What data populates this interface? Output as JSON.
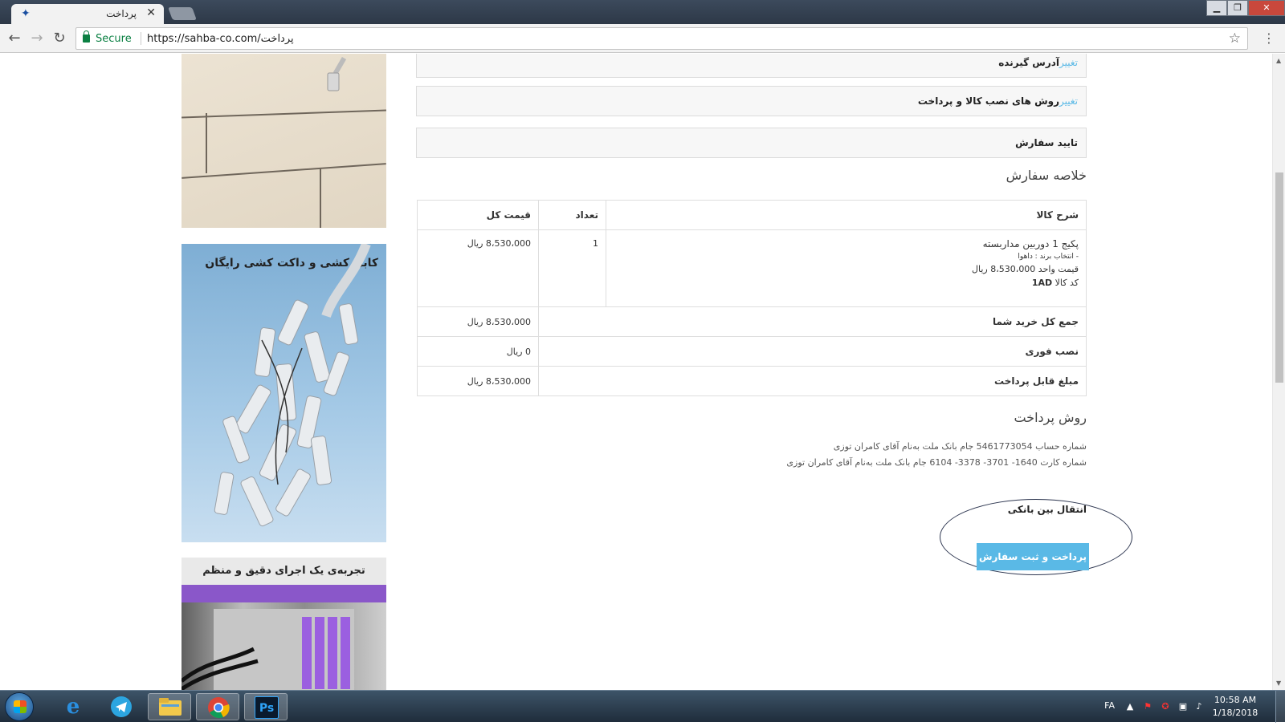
{
  "browser": {
    "tab_title": "پرداخت",
    "secure_label": "Secure",
    "url": "https://sahba-co.com/پرداخت"
  },
  "checkout": {
    "steps": [
      {
        "change_label": "تغییر",
        "label": "آدرس گیرنده"
      },
      {
        "change_label": "تغییر",
        "label": "روش های نصب کالا و پرداخت"
      },
      {
        "change_label": "",
        "label": "تایید سفارش"
      }
    ],
    "summary_title": "خلاصه سفارش",
    "table": {
      "headers": {
        "description": "شرح کالا",
        "quantity": "تعداد",
        "total_price": "قیمت کل"
      },
      "item": {
        "name": "پکیج 1 دوربین مداربسته",
        "option": "- انتخاب برند : داهوا",
        "unit_price": "قیمت واحد 8،530،000 ریال",
        "code_label": "کد کالا",
        "code": "1AD",
        "quantity": "1",
        "total": "8،530،000 ریال"
      },
      "totals": [
        {
          "label": "جمع کل خرید شما",
          "value": "8،530،000 ریال"
        },
        {
          "label": "نصب فوری",
          "value": "0 ریال"
        },
        {
          "label": "مبلغ قابل پرداخت",
          "value": "8،530،000 ریال"
        }
      ]
    },
    "payment_title": "روش پرداخت",
    "payment_lines": [
      "شماره حساب 5461773054 جام بانک ملت به‌نام آقای کامران توزی",
      "شماره کارت 1640- 3701- 3378- 6104 جام بانک ملت به‌نام آقای کامران توزی"
    ],
    "transfer_label": "انتقال بین بانکی",
    "submit_label": "پرداخت و ثبت سفارش"
  },
  "sidebar": {
    "banner2_title": "کابل کشی و داکت کشی رایگان",
    "banner3_title": "تجربه‌ی یک اجرای دقیق و منظم"
  },
  "taskbar": {
    "language": "FA",
    "time": "10:58 AM",
    "date": "1/18/2018",
    "apps": [
      "internet-explorer",
      "telegram",
      "file-explorer",
      "chrome",
      "photoshop"
    ]
  },
  "colors": {
    "accent": "#5ab9e6",
    "secure": "#0b8043"
  }
}
